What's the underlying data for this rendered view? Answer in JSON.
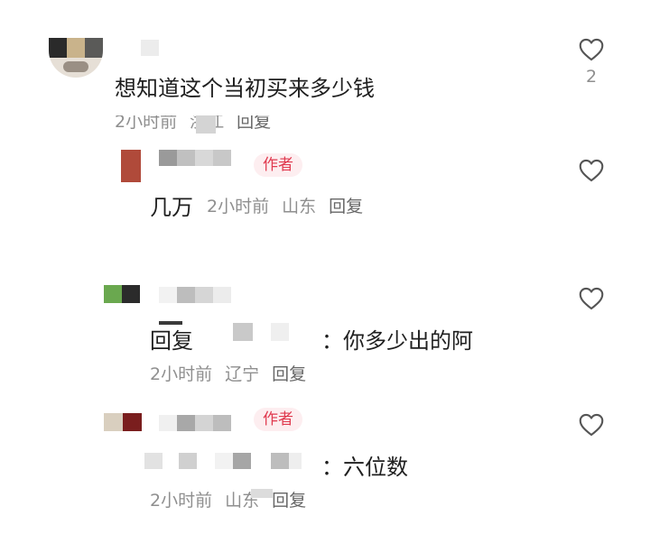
{
  "comments": [
    {
      "text": "想知道这个当初买来多少钱",
      "meta": {
        "time": "2小时前",
        "location": "浙江",
        "reply": "回复"
      },
      "likes": "2",
      "author": false
    },
    {
      "text": "几万",
      "meta": {
        "time": "2小时前",
        "location": "山东",
        "reply": "回复"
      },
      "author": true
    },
    {
      "text_prefix": "回复",
      "text_suffix": "：你多少出的阿",
      "meta": {
        "time": "2小时前",
        "location": "辽宁",
        "reply": "回复"
      },
      "author": false
    },
    {
      "text_suffix": "：六位数",
      "meta": {
        "time": "2小时前",
        "location": "山东",
        "reply": "回复"
      },
      "author": true
    }
  ],
  "author_badge": "作者",
  "colors": {
    "badge_bg": "#fdeef0",
    "badge_text": "#e03a4f",
    "meta": "#8f8f8f",
    "text": "#1f1f1f"
  },
  "icons": {
    "like": "heart-outline-icon"
  }
}
